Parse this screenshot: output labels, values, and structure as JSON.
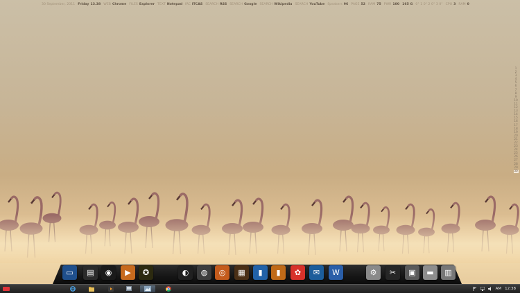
{
  "topbar": {
    "date": "30 September, 2011",
    "day": "Friday",
    "time": "13.38",
    "items": [
      {
        "label": "WEB",
        "value": "Chrome"
      },
      {
        "label": "FILES",
        "value": "Explorer"
      },
      {
        "label": "TEXT",
        "value": "Notepad"
      },
      {
        "label": "IRC",
        "value": "ITCAS"
      },
      {
        "label": "SEARCH",
        "value": "RSS"
      },
      {
        "label": "SEARCH",
        "value": "Google"
      },
      {
        "label": "SEARCH",
        "value": "Wikipedia"
      },
      {
        "label": "SEARCH",
        "value": "YouTube"
      },
      {
        "label": "Speakers",
        "value": "96"
      },
      {
        "label": "PAGE",
        "value": "52"
      },
      {
        "label": "RAM",
        "value": "75"
      },
      {
        "label": "PWR",
        "value": "100"
      },
      {
        "label": "",
        "value": "165 G"
      }
    ],
    "weather": "0° 1 0° 2 0° 3 0°",
    "cpu_label": "CPU",
    "cpu_value": "3",
    "cpu2_label": "RAM",
    "cpu2_value": "0"
  },
  "calendar": {
    "days": [
      "1",
      "2",
      "3",
      "4",
      "5",
      "6",
      "7",
      "8",
      "9",
      "10",
      "11",
      "12",
      "13",
      "14",
      "15",
      "16",
      "17",
      "18",
      "19",
      "20",
      "21",
      "22",
      "23",
      "24",
      "25",
      "26",
      "27",
      "28",
      "29",
      "30"
    ],
    "today": "30"
  },
  "dock": {
    "icons": [
      {
        "name": "monitor-icon",
        "bg": "#1f4f8c"
      },
      {
        "name": "control-panel-icon",
        "bg": "#2b2b2b"
      },
      {
        "name": "camera-icon",
        "bg": "#1a1a1a"
      },
      {
        "name": "media-player-icon",
        "bg": "#c76a1e"
      },
      {
        "name": "winamp-icon",
        "bg": "#2c2a10"
      },
      {
        "name": "mouse-icon",
        "bg": "#202020"
      },
      {
        "name": "chrome-icon",
        "bg": "#3d3d3d"
      },
      {
        "name": "speaker-icon",
        "bg": "#c45b1c"
      },
      {
        "name": "radio-icon",
        "bg": "#4a2f16"
      },
      {
        "name": "archive-blue-icon",
        "bg": "#2262a8"
      },
      {
        "name": "archive-orange-icon",
        "bg": "#c06a18"
      },
      {
        "name": "corel-icon",
        "bg": "#d8322a"
      },
      {
        "name": "chat-icon",
        "bg": "#1c5d9b"
      },
      {
        "name": "word-icon",
        "bg": "#2a5ea8"
      },
      {
        "name": "settings-icon",
        "bg": "#8a8a8a"
      },
      {
        "name": "tools-icon",
        "bg": "#262626"
      },
      {
        "name": "router-icon",
        "bg": "#5a5a5a"
      },
      {
        "name": "usb-drive-icon",
        "bg": "#8d8d8d"
      },
      {
        "name": "equalizer-icon",
        "bg": "#777777"
      }
    ]
  },
  "taskbar": {
    "clock_period": "AM",
    "clock_time": "12:38"
  }
}
